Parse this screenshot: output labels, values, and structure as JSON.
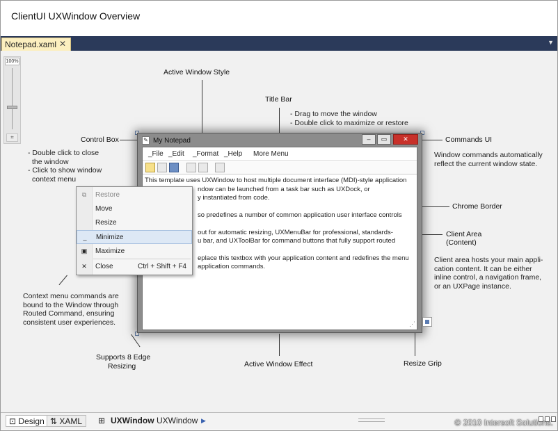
{
  "page": {
    "title": "ClientUI UXWindow Overview"
  },
  "doc_tab": {
    "label": "Notepad.xaml",
    "close": "✕"
  },
  "zoom": {
    "label": "100%"
  },
  "annotations": {
    "active_window_style": "Active Window Style",
    "title_bar": "Title Bar",
    "title_bar_desc1": "- Drag to move the window",
    "title_bar_desc2": "- Double click to maximize or restore",
    "control_box": "Control Box",
    "control_box_desc1": "- Double click to close",
    "control_box_desc2": "the window",
    "control_box_desc3": "- Click to show window",
    "control_box_desc4": "context menu",
    "commands_ui": "Commands UI",
    "commands_ui_desc1": "Window commands automatically",
    "commands_ui_desc2": "reflect the current window state.",
    "chrome_border": "Chrome Border",
    "client_area1": "Client Area",
    "client_area2": "(Content)",
    "client_area_desc1": "Client area hosts your main appli-",
    "client_area_desc2": "cation content. It can be either",
    "client_area_desc3": "inline control, a navigation frame,",
    "client_area_desc4": "or an UXPage instance.",
    "context_menu_desc1": "Context menu commands are",
    "context_menu_desc2": "bound to the Window through",
    "context_menu_desc3": "Routed Command, ensuring",
    "context_menu_desc4": "consistent user experiences.",
    "supports_resizing1": "Supports 8 Edge",
    "supports_resizing2": "Resizing",
    "active_window_effect": "Active Window Effect",
    "resize_grip": "Resize Grip"
  },
  "window": {
    "title": "My Notepad",
    "menu": [
      "_File",
      "_Edit",
      "_Format",
      "_Help",
      "More Menu"
    ],
    "text_p1_l1": "This template uses UXWindow to host multiple document interface (MDI)-style application",
    "text_p1_l2": "ndow can be launched from a task bar such as UXDock, or",
    "text_p1_l3": "y instantiated from code.",
    "text_p2_l1": "so predefines  a number of common application user interface controls such",
    "text_p2_l2": "out for automatic resizing, UXMenuBar for professional, standards-",
    "text_p2_l3": "u bar, and UXToolBar for command buttons that fully support routed",
    "text_p3_l1": "eplace this textbox with your application content and redefines the menu",
    "text_p3_l2": "application commands."
  },
  "context_menu": {
    "items": [
      {
        "label": "Restore",
        "icon": "restore-icon",
        "shortcut": ""
      },
      {
        "label": "Move",
        "icon": "",
        "shortcut": ""
      },
      {
        "label": "Resize",
        "icon": "",
        "shortcut": ""
      },
      {
        "label": "Minimize",
        "icon": "minimize-icon",
        "shortcut": ""
      },
      {
        "label": "Maximize",
        "icon": "maximize-icon",
        "shortcut": ""
      },
      {
        "label": "Close",
        "icon": "close-icon",
        "shortcut": "Ctrl + Shift + F4"
      }
    ]
  },
  "bottom": {
    "design_tab": "Design",
    "xaml_tab": "XAML",
    "crumb1": "UXWindow",
    "crumb2": "UXWindow",
    "copyright": "© 2010 Intersoft Solutions."
  }
}
